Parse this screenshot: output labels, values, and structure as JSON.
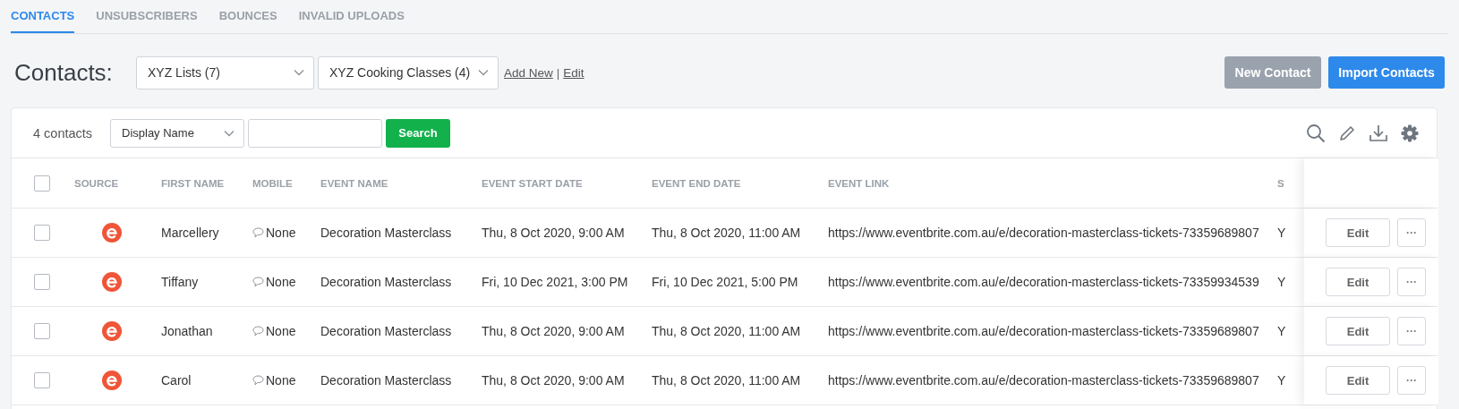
{
  "tabs": [
    {
      "label": "CONTACTS",
      "selected": true
    },
    {
      "label": "UNSUBSCRIBERS",
      "selected": false
    },
    {
      "label": "BOUNCES",
      "selected": false
    },
    {
      "label": "INVALID UPLOADS",
      "selected": false
    }
  ],
  "header": {
    "title": "Contacts:",
    "list_select": "XYZ Lists (7)",
    "group_select": "XYZ Cooking Classes (4)",
    "add_new": "Add New",
    "separator": "|",
    "edit": "Edit",
    "buttons": [
      {
        "label": "New Contact",
        "kind": "secondary"
      },
      {
        "label": "Import Contacts",
        "kind": "primary"
      }
    ]
  },
  "toolbar": {
    "count": "4 contacts",
    "field_select": "Display Name",
    "search_button": "Search"
  },
  "table": {
    "select_all": {
      "checked": false
    },
    "columns": [
      "SOURCE",
      "FIRST NAME",
      "MOBILE",
      "EVENT NAME",
      "EVENT START DATE",
      "EVENT END DATE",
      "EVENT LINK",
      "S"
    ],
    "rows": [
      {
        "checked": false,
        "first_name": "Marcellery",
        "mobile": "None",
        "event_name": "Decoration Masterclass",
        "start": "Thu, 8 Oct 2020, 9:00 AM",
        "end": "Thu, 8 Oct 2020, 11:00 AM",
        "link": "https://www.eventbrite.com.au/e/decoration-masterclass-tickets-73359689807",
        "column_9": "Y",
        "edit": "Edit",
        "more": "···"
      },
      {
        "checked": false,
        "first_name": "Tiffany",
        "mobile": "None",
        "event_name": "Decoration Masterclass",
        "start": "Fri, 10 Dec 2021, 3:00 PM",
        "end": "Fri, 10 Dec 2021, 5:00 PM",
        "link": "https://www.eventbrite.com.au/e/decoration-masterclass-tickets-73359934539",
        "column_9": "Y",
        "edit": "Edit",
        "more": "···"
      },
      {
        "checked": false,
        "first_name": "Jonathan",
        "mobile": "None",
        "event_name": "Decoration Masterclass",
        "start": "Thu, 8 Oct 2020, 9:00 AM",
        "end": "Thu, 8 Oct 2020, 11:00 AM",
        "link": "https://www.eventbrite.com.au/e/decoration-masterclass-tickets-73359689807",
        "column_9": "Y",
        "edit": "Edit",
        "more": "···"
      },
      {
        "checked": false,
        "first_name": "Carol",
        "mobile": "None",
        "event_name": "Decoration Masterclass",
        "start": "Thu, 8 Oct 2020, 9:00 AM",
        "end": "Thu, 8 Oct 2020, 11:00 AM",
        "link": "https://www.eventbrite.com.au/e/decoration-masterclass-tickets-73359689807",
        "column_9": "Y",
        "edit": "Edit",
        "more": "···"
      }
    ]
  }
}
